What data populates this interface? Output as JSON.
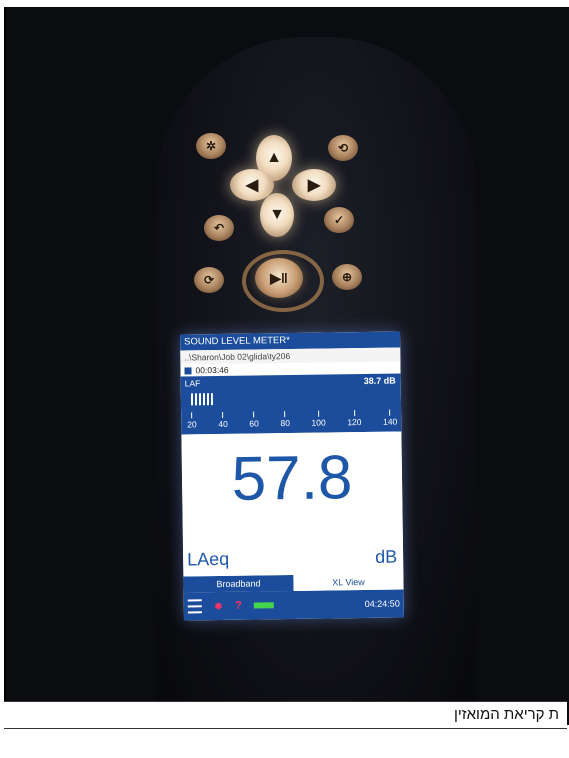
{
  "screen": {
    "title": "SOUND LEVEL METER*",
    "path": "..\\Sharon\\Job 02\\glida\\ty206",
    "elapsed": "00:03:46",
    "weighting": "LAF",
    "instant_level": "38.7 dB",
    "scale_ticks": [
      "20",
      "40",
      "60",
      "80",
      "100",
      "120",
      "140"
    ],
    "main_value": "57.8",
    "main_label": "LAeq",
    "unit": "dB",
    "tab_broadband": "Broadband",
    "tab_xl_view": "XL View",
    "clock": "04:24:50",
    "help_icon": "?"
  },
  "caption": "ת קריאת המואזין",
  "icons": [
    "menu-icon",
    "light-icon",
    "help-icon",
    "battery-icon"
  ]
}
